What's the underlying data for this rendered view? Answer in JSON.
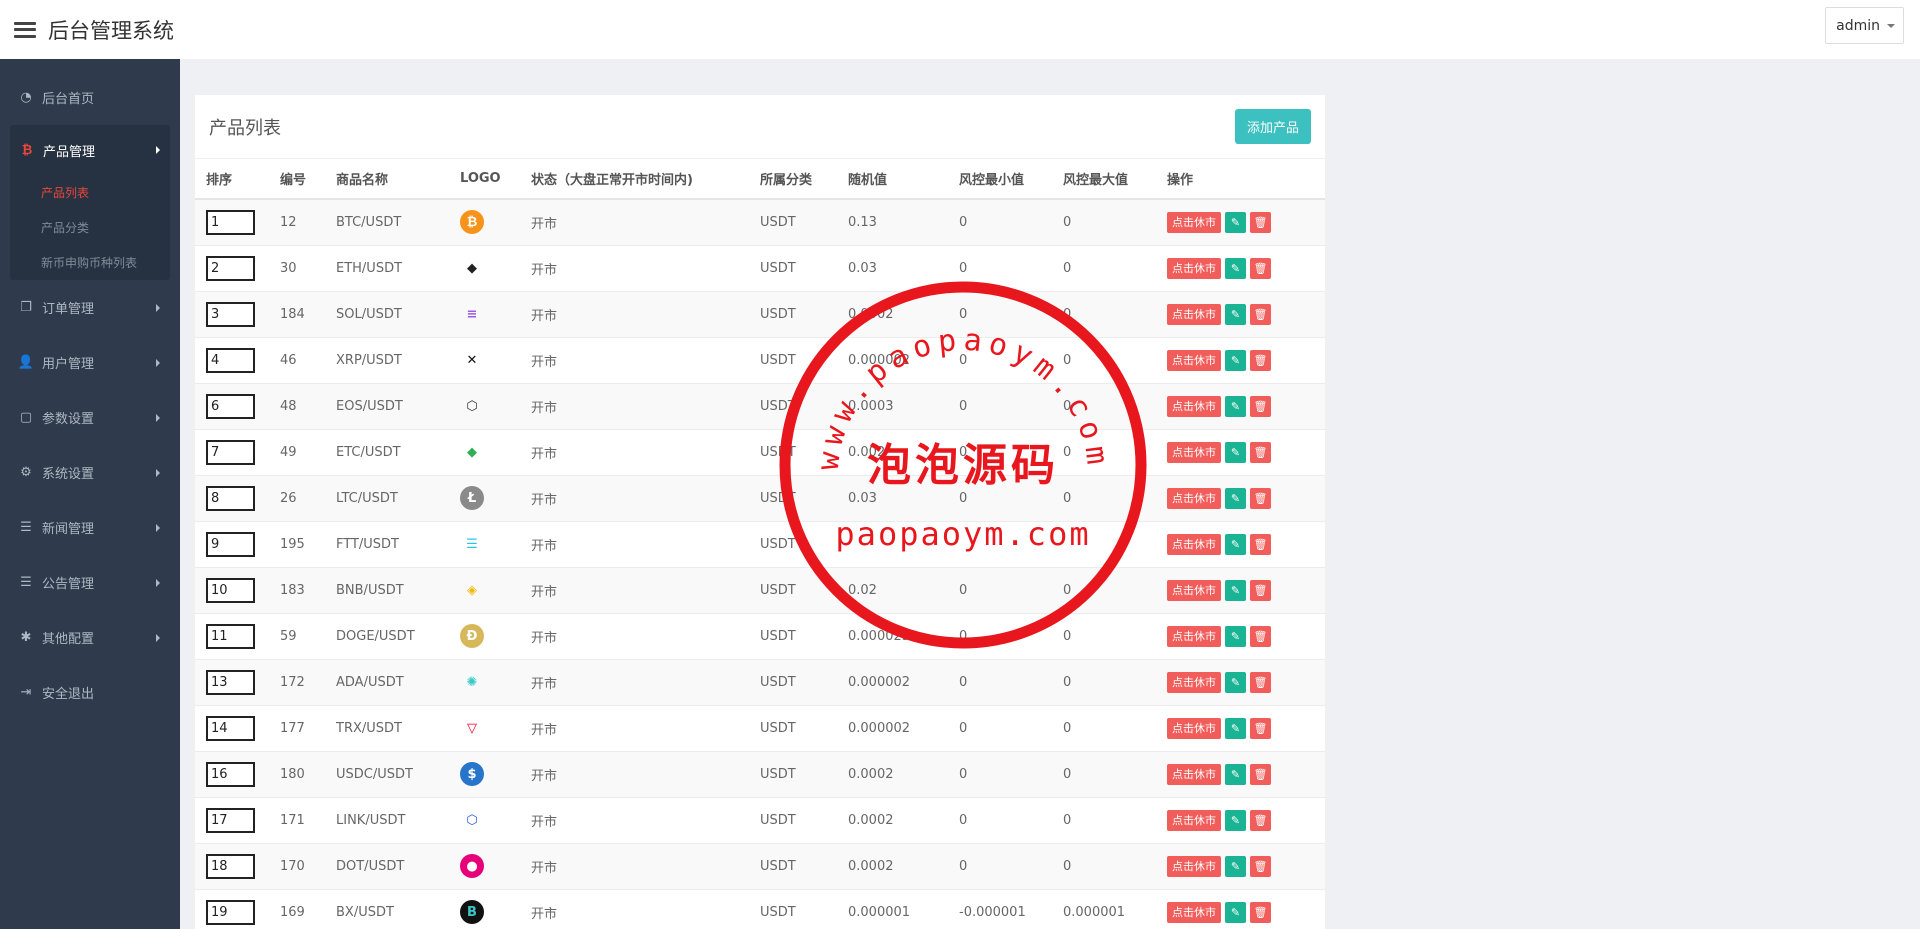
{
  "header": {
    "title": "后台管理系统",
    "user": "admin"
  },
  "sidebar": {
    "items": [
      {
        "label": "后台首页",
        "icon": "dashboard-icon",
        "glyph": "◔",
        "arrow": false
      },
      {
        "label": "产品管理",
        "icon": "bitcoin-icon",
        "glyph": "₿",
        "arrow": true,
        "expanded": true,
        "children": [
          {
            "label": "产品列表",
            "active": true
          },
          {
            "label": "产品分类",
            "active": false
          },
          {
            "label": "新币申购币种列表",
            "active": false
          }
        ]
      },
      {
        "label": "订单管理",
        "icon": "copy-icon",
        "glyph": "❐",
        "arrow": true
      },
      {
        "label": "用户管理",
        "icon": "user-icon",
        "glyph": "👤",
        "arrow": true
      },
      {
        "label": "参数设置",
        "icon": "file-icon",
        "glyph": "▢",
        "arrow": true
      },
      {
        "label": "系统设置",
        "icon": "cogs-icon",
        "glyph": "⚙",
        "arrow": true
      },
      {
        "label": "新闻管理",
        "icon": "list-icon",
        "glyph": "☰",
        "arrow": true
      },
      {
        "label": "公告管理",
        "icon": "list-icon",
        "glyph": "☰",
        "arrow": true
      },
      {
        "label": "其他配置",
        "icon": "gear-icon",
        "glyph": "✱",
        "arrow": true
      },
      {
        "label": "安全退出",
        "icon": "sign-out-icon",
        "glyph": "⇥",
        "arrow": false
      }
    ]
  },
  "panel": {
    "title": "产品列表",
    "add_button": "添加产品"
  },
  "table": {
    "columns": [
      "排序",
      "编号",
      "商品名称",
      "LOGO",
      "状态（大盘正常开市时间内)",
      "所属分类",
      "随机值",
      "风控最小值",
      "风控最大值",
      "操作"
    ],
    "actions": {
      "close_label": "点击休市",
      "edit_icon": "pencil-icon",
      "delete_icon": "trash-icon"
    },
    "rows": [
      {
        "sort": "1",
        "id": "12",
        "name": "BTC/USDT",
        "logo": "btc-logo",
        "logo_glyph": "₿",
        "logo_bg": "#f7931a",
        "logo_fg": "#ffffff",
        "status": "开市",
        "category": "USDT",
        "random": "0.13",
        "min": "0",
        "max": "0"
      },
      {
        "sort": "2",
        "id": "30",
        "name": "ETH/USDT",
        "logo": "eth-logo",
        "logo_glyph": "◆",
        "logo_bg": "transparent",
        "logo_fg": "#222222",
        "status": "开市",
        "category": "USDT",
        "random": "0.03",
        "min": "0",
        "max": "0"
      },
      {
        "sort": "3",
        "id": "184",
        "name": "SOL/USDT",
        "logo": "sol-logo",
        "logo_glyph": "≡",
        "logo_bg": "transparent",
        "logo_fg": "#9b5de5",
        "status": "开市",
        "category": "USDT",
        "random": "0.0002",
        "min": "0",
        "max": "0"
      },
      {
        "sort": "4",
        "id": "46",
        "name": "XRP/USDT",
        "logo": "xrp-logo",
        "logo_glyph": "✕",
        "logo_bg": "transparent",
        "logo_fg": "#111111",
        "status": "开市",
        "category": "USDT",
        "random": "0.000002",
        "min": "0",
        "max": "0"
      },
      {
        "sort": "6",
        "id": "48",
        "name": "EOS/USDT",
        "logo": "eos-logo",
        "logo_glyph": "⬡",
        "logo_bg": "transparent",
        "logo_fg": "#333333",
        "status": "开市",
        "category": "USDT",
        "random": "0.0003",
        "min": "0",
        "max": "0"
      },
      {
        "sort": "7",
        "id": "49",
        "name": "ETC/USDT",
        "logo": "etc-logo",
        "logo_glyph": "◆",
        "logo_bg": "transparent",
        "logo_fg": "#2fae56",
        "status": "开市",
        "category": "USDT",
        "random": "0.002",
        "min": "0",
        "max": "0"
      },
      {
        "sort": "8",
        "id": "26",
        "name": "LTC/USDT",
        "logo": "ltc-logo",
        "logo_glyph": "Ł",
        "logo_bg": "#8a8a8a",
        "logo_fg": "#ffffff",
        "status": "开市",
        "category": "USDT",
        "random": "0.03",
        "min": "0",
        "max": "0"
      },
      {
        "sort": "9",
        "id": "195",
        "name": "FTT/USDT",
        "logo": "ftt-logo",
        "logo_glyph": "☰",
        "logo_bg": "transparent",
        "logo_fg": "#35c3e4",
        "status": "开市",
        "category": "USDT",
        "random": "",
        "min": "",
        "max": ""
      },
      {
        "sort": "10",
        "id": "183",
        "name": "BNB/USDT",
        "logo": "bnb-logo",
        "logo_glyph": "◈",
        "logo_bg": "transparent",
        "logo_fg": "#f0b90b",
        "status": "开市",
        "category": "USDT",
        "random": "0.02",
        "min": "0",
        "max": "0"
      },
      {
        "sort": "11",
        "id": "59",
        "name": "DOGE/USDT",
        "logo": "doge-logo",
        "logo_glyph": "Ð",
        "logo_bg": "#d6b85a",
        "logo_fg": "#ffffff",
        "status": "开市",
        "category": "USDT",
        "random": "0.000025",
        "min": "0",
        "max": "0"
      },
      {
        "sort": "13",
        "id": "172",
        "name": "ADA/USDT",
        "logo": "ada-logo",
        "logo_glyph": "✺",
        "logo_bg": "transparent",
        "logo_fg": "#3cc8c8",
        "status": "开市",
        "category": "USDT",
        "random": "0.000002",
        "min": "0",
        "max": "0"
      },
      {
        "sort": "14",
        "id": "177",
        "name": "TRX/USDT",
        "logo": "trx-logo",
        "logo_glyph": "▽",
        "logo_bg": "transparent",
        "logo_fg": "#ef0027",
        "status": "开市",
        "category": "USDT",
        "random": "0.000002",
        "min": "0",
        "max": "0"
      },
      {
        "sort": "16",
        "id": "180",
        "name": "USDC/USDT",
        "logo": "usdc-logo",
        "logo_glyph": "$",
        "logo_bg": "#2775ca",
        "logo_fg": "#ffffff",
        "status": "开市",
        "category": "USDT",
        "random": "0.0002",
        "min": "0",
        "max": "0"
      },
      {
        "sort": "17",
        "id": "171",
        "name": "LINK/USDT",
        "logo": "link-logo",
        "logo_glyph": "⬡",
        "logo_bg": "transparent",
        "logo_fg": "#2a5ada",
        "status": "开市",
        "category": "USDT",
        "random": "0.0002",
        "min": "0",
        "max": "0"
      },
      {
        "sort": "18",
        "id": "170",
        "name": "DOT/USDT",
        "logo": "dot-logo",
        "logo_glyph": "●",
        "logo_bg": "#e6007a",
        "logo_fg": "#ffffff",
        "status": "开市",
        "category": "USDT",
        "random": "0.0002",
        "min": "0",
        "max": "0"
      },
      {
        "sort": "19",
        "id": "169",
        "name": "BX/USDT",
        "logo": "bx-logo",
        "logo_glyph": "B",
        "logo_bg": "#111111",
        "logo_fg": "#3cc8c8",
        "status": "开市",
        "category": "USDT",
        "random": "0.000001",
        "min": "-0.000001",
        "max": "0.000001"
      }
    ]
  },
  "watermark": {
    "top_text": "www.paopaoym.com",
    "center_text": "泡泡源码",
    "bottom_text": "paopaoym.com",
    "color": "#e8161d"
  }
}
